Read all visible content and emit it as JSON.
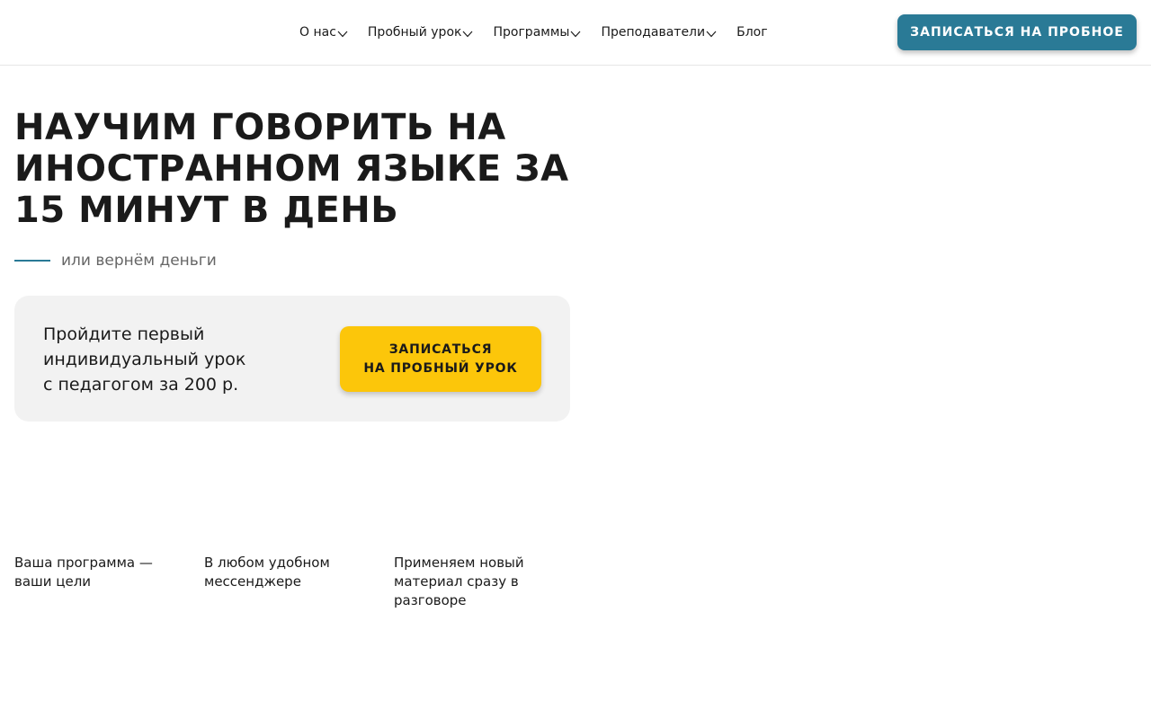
{
  "nav": {
    "items": [
      {
        "label": "О нас",
        "has_dropdown": true
      },
      {
        "label": "Пробный урок",
        "has_dropdown": true
      },
      {
        "label": "Программы",
        "has_dropdown": true
      },
      {
        "label": "Преподаватели",
        "has_dropdown": true
      },
      {
        "label": "Блог",
        "has_dropdown": false
      }
    ],
    "cta_label": "ЗАПИСАТЬСЯ НА ПРОБНОЕ"
  },
  "hero": {
    "title_lines": [
      "НАУЧИМ ГОВОРИТЬ НА",
      "ИНОСТРАННОМ ЯЗЫКЕ ЗА",
      "15 МИНУТ В ДЕНЬ"
    ],
    "subtitle": "или вернём деньги"
  },
  "offer": {
    "text_lines": [
      "Пройдите первый",
      "индивидуальный урок",
      "с педагогом за 200 р."
    ],
    "button_lines": [
      "ЗАПИСАТЬСЯ",
      "НА ПРОБНЫЙ УРОК"
    ]
  },
  "features": [
    {
      "lines": [
        "Ваша программа —",
        "ваши цели"
      ]
    },
    {
      "lines": [
        "В любом удобном",
        "мессенджере"
      ]
    },
    {
      "lines": [
        "Применяем новый",
        "материал сразу в",
        "разговоре"
      ]
    }
  ],
  "colors": {
    "accent": "#2a7a96",
    "yellow": "#fcc60a",
    "card_bg": "#f2f2f2"
  },
  "icons": {
    "dropdown": "chevron-down-icon"
  }
}
